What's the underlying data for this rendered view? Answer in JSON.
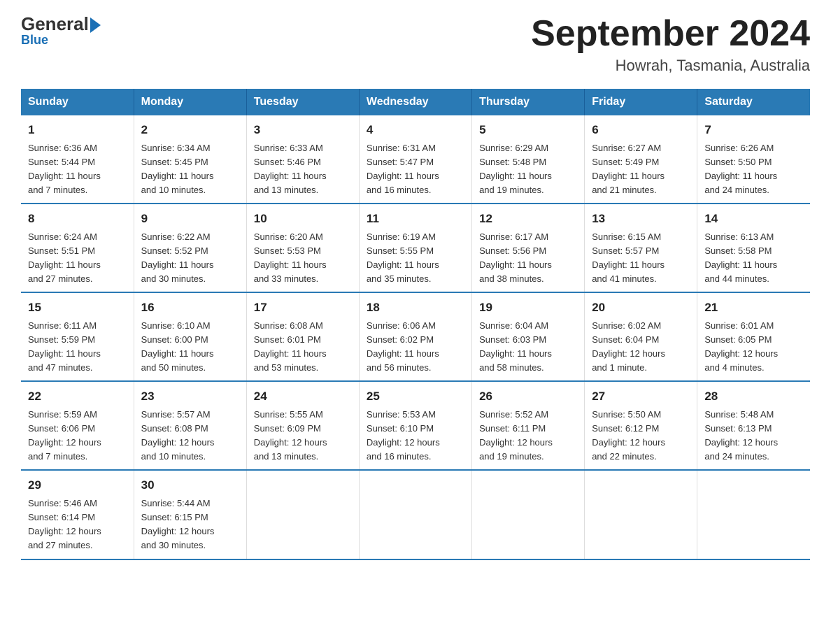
{
  "header": {
    "logo_general": "General",
    "logo_blue": "Blue",
    "month_title": "September 2024",
    "location": "Howrah, Tasmania, Australia"
  },
  "days_of_week": [
    "Sunday",
    "Monday",
    "Tuesday",
    "Wednesday",
    "Thursday",
    "Friday",
    "Saturday"
  ],
  "weeks": [
    [
      {
        "day": "1",
        "info": "Sunrise: 6:36 AM\nSunset: 5:44 PM\nDaylight: 11 hours\nand 7 minutes."
      },
      {
        "day": "2",
        "info": "Sunrise: 6:34 AM\nSunset: 5:45 PM\nDaylight: 11 hours\nand 10 minutes."
      },
      {
        "day": "3",
        "info": "Sunrise: 6:33 AM\nSunset: 5:46 PM\nDaylight: 11 hours\nand 13 minutes."
      },
      {
        "day": "4",
        "info": "Sunrise: 6:31 AM\nSunset: 5:47 PM\nDaylight: 11 hours\nand 16 minutes."
      },
      {
        "day": "5",
        "info": "Sunrise: 6:29 AM\nSunset: 5:48 PM\nDaylight: 11 hours\nand 19 minutes."
      },
      {
        "day": "6",
        "info": "Sunrise: 6:27 AM\nSunset: 5:49 PM\nDaylight: 11 hours\nand 21 minutes."
      },
      {
        "day": "7",
        "info": "Sunrise: 6:26 AM\nSunset: 5:50 PM\nDaylight: 11 hours\nand 24 minutes."
      }
    ],
    [
      {
        "day": "8",
        "info": "Sunrise: 6:24 AM\nSunset: 5:51 PM\nDaylight: 11 hours\nand 27 minutes."
      },
      {
        "day": "9",
        "info": "Sunrise: 6:22 AM\nSunset: 5:52 PM\nDaylight: 11 hours\nand 30 minutes."
      },
      {
        "day": "10",
        "info": "Sunrise: 6:20 AM\nSunset: 5:53 PM\nDaylight: 11 hours\nand 33 minutes."
      },
      {
        "day": "11",
        "info": "Sunrise: 6:19 AM\nSunset: 5:55 PM\nDaylight: 11 hours\nand 35 minutes."
      },
      {
        "day": "12",
        "info": "Sunrise: 6:17 AM\nSunset: 5:56 PM\nDaylight: 11 hours\nand 38 minutes."
      },
      {
        "day": "13",
        "info": "Sunrise: 6:15 AM\nSunset: 5:57 PM\nDaylight: 11 hours\nand 41 minutes."
      },
      {
        "day": "14",
        "info": "Sunrise: 6:13 AM\nSunset: 5:58 PM\nDaylight: 11 hours\nand 44 minutes."
      }
    ],
    [
      {
        "day": "15",
        "info": "Sunrise: 6:11 AM\nSunset: 5:59 PM\nDaylight: 11 hours\nand 47 minutes."
      },
      {
        "day": "16",
        "info": "Sunrise: 6:10 AM\nSunset: 6:00 PM\nDaylight: 11 hours\nand 50 minutes."
      },
      {
        "day": "17",
        "info": "Sunrise: 6:08 AM\nSunset: 6:01 PM\nDaylight: 11 hours\nand 53 minutes."
      },
      {
        "day": "18",
        "info": "Sunrise: 6:06 AM\nSunset: 6:02 PM\nDaylight: 11 hours\nand 56 minutes."
      },
      {
        "day": "19",
        "info": "Sunrise: 6:04 AM\nSunset: 6:03 PM\nDaylight: 11 hours\nand 58 minutes."
      },
      {
        "day": "20",
        "info": "Sunrise: 6:02 AM\nSunset: 6:04 PM\nDaylight: 12 hours\nand 1 minute."
      },
      {
        "day": "21",
        "info": "Sunrise: 6:01 AM\nSunset: 6:05 PM\nDaylight: 12 hours\nand 4 minutes."
      }
    ],
    [
      {
        "day": "22",
        "info": "Sunrise: 5:59 AM\nSunset: 6:06 PM\nDaylight: 12 hours\nand 7 minutes."
      },
      {
        "day": "23",
        "info": "Sunrise: 5:57 AM\nSunset: 6:08 PM\nDaylight: 12 hours\nand 10 minutes."
      },
      {
        "day": "24",
        "info": "Sunrise: 5:55 AM\nSunset: 6:09 PM\nDaylight: 12 hours\nand 13 minutes."
      },
      {
        "day": "25",
        "info": "Sunrise: 5:53 AM\nSunset: 6:10 PM\nDaylight: 12 hours\nand 16 minutes."
      },
      {
        "day": "26",
        "info": "Sunrise: 5:52 AM\nSunset: 6:11 PM\nDaylight: 12 hours\nand 19 minutes."
      },
      {
        "day": "27",
        "info": "Sunrise: 5:50 AM\nSunset: 6:12 PM\nDaylight: 12 hours\nand 22 minutes."
      },
      {
        "day": "28",
        "info": "Sunrise: 5:48 AM\nSunset: 6:13 PM\nDaylight: 12 hours\nand 24 minutes."
      }
    ],
    [
      {
        "day": "29",
        "info": "Sunrise: 5:46 AM\nSunset: 6:14 PM\nDaylight: 12 hours\nand 27 minutes."
      },
      {
        "day": "30",
        "info": "Sunrise: 5:44 AM\nSunset: 6:15 PM\nDaylight: 12 hours\nand 30 minutes."
      },
      {
        "day": "",
        "info": ""
      },
      {
        "day": "",
        "info": ""
      },
      {
        "day": "",
        "info": ""
      },
      {
        "day": "",
        "info": ""
      },
      {
        "day": "",
        "info": ""
      }
    ]
  ]
}
